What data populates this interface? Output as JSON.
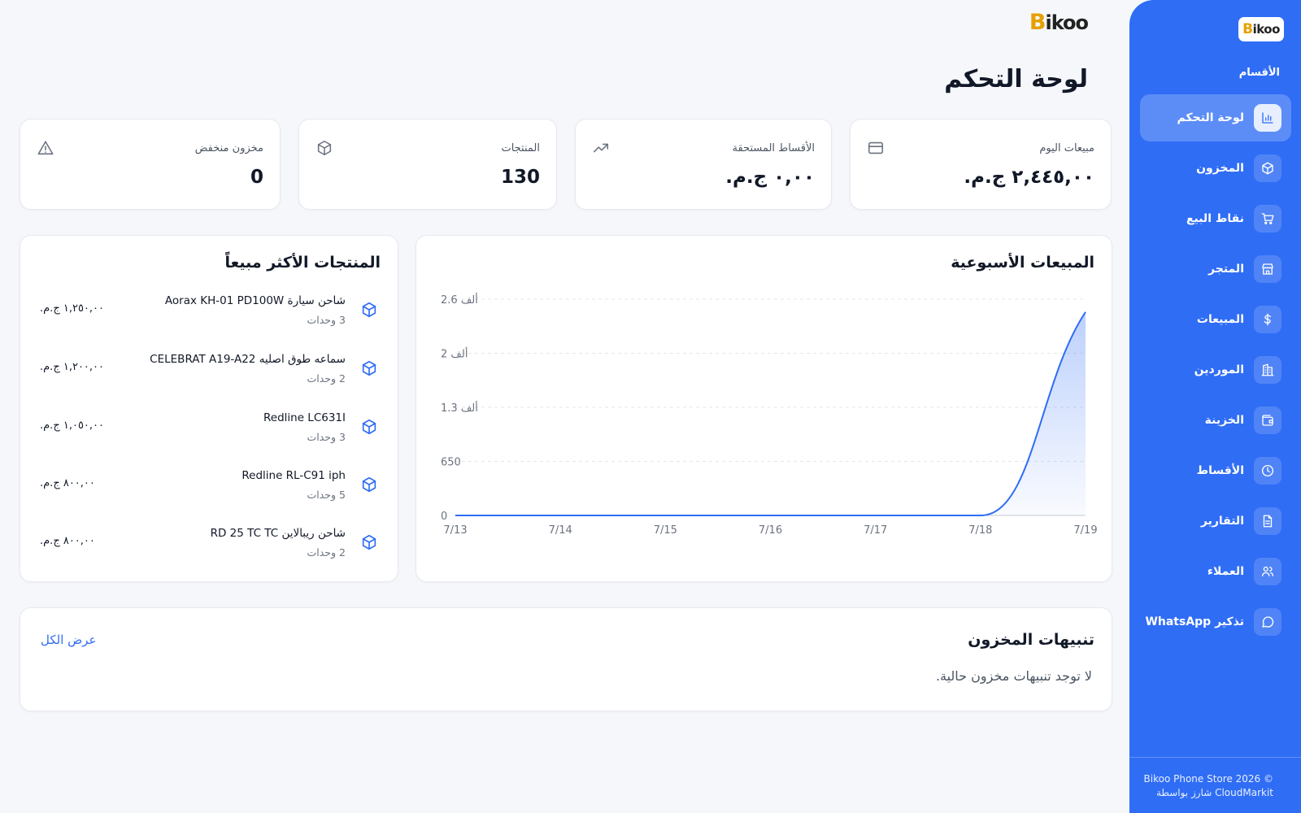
{
  "brand": {
    "logo_first": "B",
    "logo_rest": "ikoo"
  },
  "sidebar": {
    "section_title": "الأقسام",
    "items": [
      {
        "label": "لوحة التحكم",
        "icon": "chart-bar-icon",
        "active": true
      },
      {
        "label": "المخزون",
        "icon": "box-icon"
      },
      {
        "label": "نقاط البيع",
        "icon": "cart-icon"
      },
      {
        "label": "المتجر",
        "icon": "store-icon"
      },
      {
        "label": "المبيعات",
        "icon": "dollar-icon"
      },
      {
        "label": "الموردين",
        "icon": "building-icon"
      },
      {
        "label": "الخزينة",
        "icon": "wallet-icon"
      },
      {
        "label": "الأقساط",
        "icon": "clock-icon"
      },
      {
        "label": "التقارير",
        "icon": "report-icon"
      },
      {
        "label": "العملاء",
        "icon": "users-icon"
      },
      {
        "label": "تذكير WhatsApp",
        "icon": "chat-icon"
      }
    ],
    "footer_line1": "Bikoo Phone Store 2026 ©",
    "footer_line2": "شارز بواسطة CloudMarkit"
  },
  "page_title": "لوحة التحكم",
  "stats": {
    "today_sales": {
      "label": "مبيعات اليوم",
      "value": "٢,٤٤٥,٠٠ ج.م.",
      "icon": "credit-card-icon"
    },
    "due_installments": {
      "label": "الأقساط المستحقة",
      "value": "٠,٠٠ ج.م.",
      "icon": "trending-up-icon"
    },
    "products": {
      "label": "المنتجات",
      "value": "130",
      "icon": "box-icon"
    },
    "low_stock": {
      "label": "مخزون منخفض",
      "value": "0",
      "icon": "warning-icon"
    }
  },
  "weekly_sales": {
    "title": "المبيعات الأسبوعية"
  },
  "chart_data": {
    "type": "area",
    "title": "المبيعات الأسبوعية",
    "x": [
      "7/13",
      "7/14",
      "7/15",
      "7/16",
      "7/17",
      "7/18",
      "7/19"
    ],
    "series": [
      {
        "values": [
          0,
          0,
          0,
          0,
          0,
          0,
          2445
        ]
      }
    ],
    "y_ticks": [
      "0",
      "650",
      "1.3 ألف",
      "2 ألف",
      "2.6 ألف"
    ],
    "ylim": [
      0,
      2600
    ],
    "grid": true,
    "color": "#2f6df5"
  },
  "top_products": {
    "title": "المنتجات الأكثر مبيعاً",
    "items": [
      {
        "name": "شاحن سيارة Aorax KH-01 PD100W",
        "units": "3 وحدات",
        "price": "١,٢٥٠,٠٠ ج.م."
      },
      {
        "name": "سماعه طوق اصليه CELEBRAT A19-A22",
        "units": "2 وحدات",
        "price": "١,٢٠٠,٠٠ ج.م."
      },
      {
        "name": "Redline LC631I",
        "units": "3 وحدات",
        "price": "١,٠٥٠,٠٠ ج.م."
      },
      {
        "name": "Redline RL-C91 iph",
        "units": "5 وحدات",
        "price": "٨٠٠,٠٠ ج.م."
      },
      {
        "name": "شاحن ريبالاين RD 25 TC TC",
        "units": "2 وحدات",
        "price": "٨٠٠,٠٠ ج.م."
      }
    ]
  },
  "stock_alerts": {
    "title": "تنبيهات المخزون",
    "view_all": "عرض الكل",
    "empty_text": "لا توجد تنبيهات مخزون حالية."
  }
}
